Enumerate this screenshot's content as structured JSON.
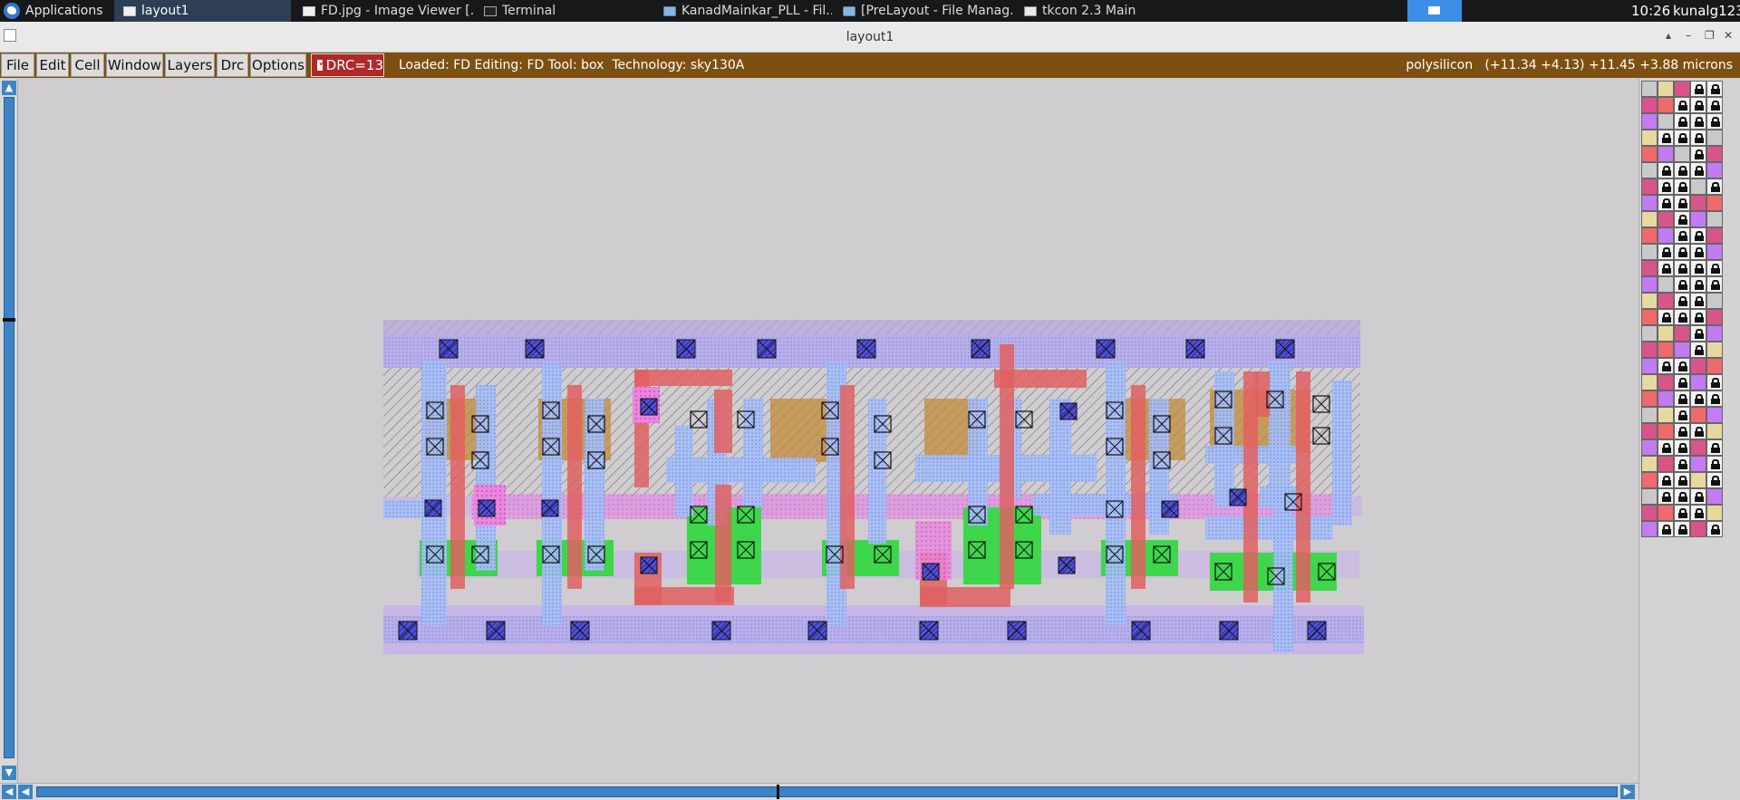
{
  "taskbar": {
    "apps_label": "Applications",
    "tasks": [
      {
        "label": "layout1",
        "icon": "window-icon",
        "active": true
      },
      {
        "label": "FD.jpg - Image Viewer [...",
        "icon": "image-icon",
        "active": false
      },
      {
        "label": "Terminal",
        "icon": "terminal-icon",
        "active": false
      },
      {
        "label": "KanadMainkar_PLL - Fil...",
        "icon": "folder-icon",
        "active": false
      },
      {
        "label": "[PreLayout - File Manag...",
        "icon": "folder-icon",
        "active": false
      },
      {
        "label": "tkcon 2.3 Main",
        "icon": "tk-icon",
        "active": false
      }
    ],
    "clock": "10:26",
    "user": "kunalg123"
  },
  "window": {
    "title": "layout1",
    "controls": [
      "▴",
      "–",
      "❐",
      "✕"
    ]
  },
  "menubar": {
    "items": [
      "File",
      "Edit",
      "Cell",
      "Window",
      "Layers",
      "Drc",
      "Options"
    ],
    "drc_label": "DRC=13",
    "status": "Loaded: FD Editing: FD Tool: box  Technology: sky130A",
    "coords": "polysilicon   (+11.34 +4.13) +11.45 +3.88 microns"
  },
  "scroll": {
    "up": "▲",
    "down": "▼",
    "left": "◀",
    "right": "▶"
  },
  "colors": {
    "menubar": "#7d5012",
    "metal1": "#b7b0ea",
    "li": "#a2b9f5",
    "poly": "#e06060",
    "pdiff": "#c28a3a",
    "ndiff": "#3ed64a",
    "nwell": "#8c8c8c",
    "via": "#3030c0",
    "implant": "#e878e0"
  },
  "palette_colors": [
    "#c9c9c9",
    "#e6e0a0",
    "#ffffff",
    "#e6d9a0",
    "#b89c68",
    "#e6b07a",
    "#d9548a",
    "#9ec77a",
    "#4cd46a",
    "#ef6a6a",
    "#7ab0e0",
    "#f07fd0",
    "#c07cf0",
    "#20c0a0",
    "#b0a0d8"
  ]
}
